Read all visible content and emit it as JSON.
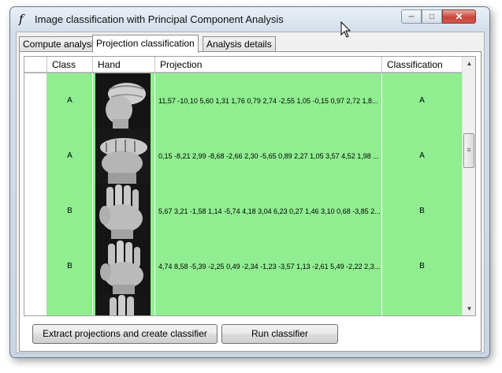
{
  "window": {
    "title": "Image classification with Principal Component Analysis",
    "app_icon": "function-f-icon",
    "controls": {
      "minimize": "─",
      "maximize": "□",
      "close": "✕"
    }
  },
  "tabs": [
    {
      "label": "Compute analysis",
      "active": false
    },
    {
      "label": "Projection classification",
      "active": true
    },
    {
      "label": "Analysis details",
      "active": false
    }
  ],
  "grid": {
    "columns": [
      "Class",
      "Hand",
      "Projection",
      "Classification"
    ],
    "rows": [
      {
        "class": "A",
        "hand": "hand-fist-image",
        "projection": "11,57 -10,10 5,60 1,31 1,76 0,79 2,74 -2,55 1,05 -0,15 0,97 2,72 1,8...",
        "classification": "A"
      },
      {
        "class": "A",
        "hand": "hand-fist-image",
        "projection": "0,15 -8,21 2,99 -8,68 -2,66 2,30 -5,65 0,89 2,27 1,05 3,57 4,52 1,98 ...",
        "classification": "A"
      },
      {
        "class": "B",
        "hand": "hand-open-image",
        "projection": "5,67 3,21 -1,58 1,14 -5,74 4,18 3,04 6,23 0,27 1,46 3,10 0,68 -3,85 2...",
        "classification": "B"
      },
      {
        "class": "B",
        "hand": "hand-open-image",
        "projection": "4,74 8,58 -5,39 -2,25 0,49 -2,34 -1,23 -3,57 1,13 -2,61 5,49 -2,22 2,3...",
        "classification": "B"
      },
      {
        "class": "",
        "hand": "hand-open-image",
        "projection": "",
        "classification": ""
      }
    ],
    "row_color": "#90ee90"
  },
  "buttons": {
    "extract": "Extract projections and create classifier",
    "run": "Run classifier"
  }
}
